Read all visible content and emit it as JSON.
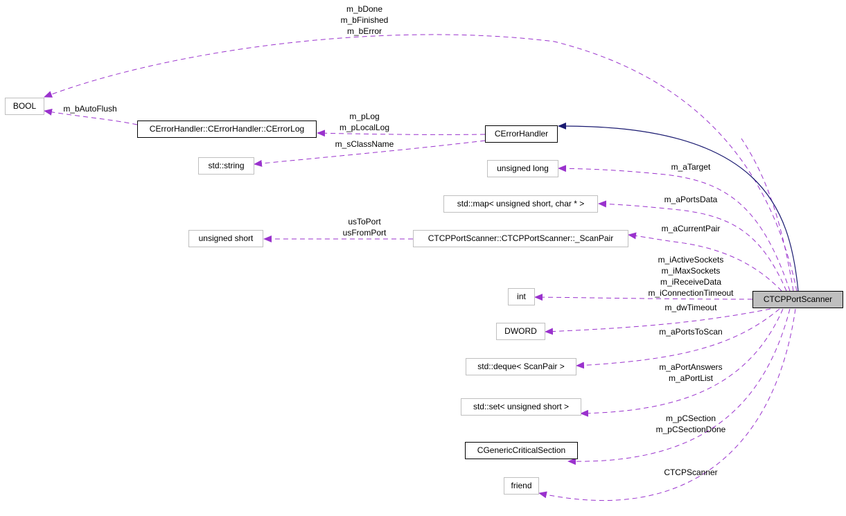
{
  "diagram": {
    "type": "collaboration-graph",
    "colors": {
      "member_edge": "#9a32cd",
      "inherit_edge": "#191970",
      "main_node_fill": "#bfbfbf",
      "undocumented_border": "#bfbfbf",
      "documented_border": "#000000"
    },
    "nodes": {
      "bool": "BOOL",
      "error_log": "CErrorHandler::CErrorHandler::CErrorLog",
      "error_handler": "CErrorHandler",
      "std_string": "std::string",
      "unsigned_long": "unsigned long",
      "std_map": "std::map< unsigned short, char * >",
      "unsigned_short": "unsigned short",
      "scan_pair": "CTCPPortScanner::CTCPPortScanner::_ScanPair",
      "int": "int",
      "dword": "DWORD",
      "std_deque": "std::deque< ScanPair >",
      "std_set": "std::set< unsigned short >",
      "critical_section": "CGenericCriticalSection",
      "friend": "friend",
      "main": "CTCPPortScanner"
    },
    "edges": {
      "bool_main": [
        "m_bDone",
        "m_bFinished",
        "m_bError"
      ],
      "bool_errorlog": [
        "m_bAutoFlush"
      ],
      "errorlog_handler": [
        "m_pLog",
        "m_pLocalLog"
      ],
      "string_handler": [
        "m_sClassName"
      ],
      "ulong_main": [
        "m_aTarget"
      ],
      "map_main": [
        "m_aPortsData"
      ],
      "ushort_scanpair": [
        "usToPort",
        "usFromPort"
      ],
      "scanpair_main": [
        "m_aCurrentPair"
      ],
      "int_main": [
        "m_iActiveSockets",
        "m_iMaxSockets",
        "m_iReceiveData",
        "m_iConnectionTimeout"
      ],
      "dword_main": [
        "m_dwTimeout"
      ],
      "deque_main": [
        "m_aPortsToScan"
      ],
      "set_main": [
        "m_aPortAnswers",
        "m_aPortList"
      ],
      "cs_main": [
        "m_pCSection",
        "m_pCSectionDone"
      ],
      "friend_main": [
        "CTCPScanner"
      ]
    }
  }
}
